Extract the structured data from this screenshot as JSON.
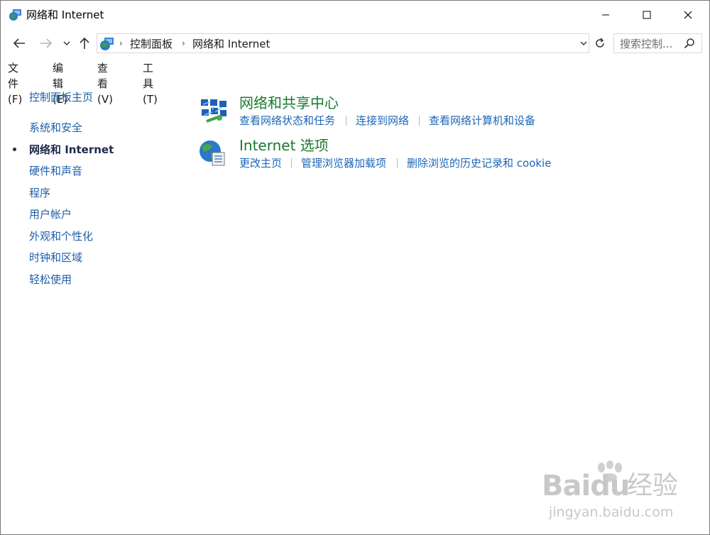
{
  "window": {
    "title": "网络和 Internet"
  },
  "address_bar": {
    "crumbs": [
      "控制面板",
      "网络和 Internet"
    ]
  },
  "search": {
    "placeholder": "搜索控制..."
  },
  "menu": {
    "items": [
      "文件(F)",
      "编辑(E)",
      "查看(V)",
      "工具(T)"
    ]
  },
  "sidebar": {
    "home": "控制面板主页",
    "items": [
      "系统和安全",
      "网络和 Internet",
      "硬件和声音",
      "程序",
      "用户帐户",
      "外观和个性化",
      "时钟和区域",
      "轻松使用"
    ],
    "active_index": 1
  },
  "categories": [
    {
      "title": "网络和共享中心",
      "icon": "network-sharing-center-icon",
      "tasks": [
        "查看网络状态和任务",
        "连接到网络",
        "查看网络计算机和设备"
      ]
    },
    {
      "title": "Internet 选项",
      "icon": "internet-options-icon",
      "tasks": [
        "更改主页",
        "管理浏览器加载项",
        "删除浏览的历史记录和 cookie"
      ]
    }
  ],
  "watermark": {
    "logo": "Baidu",
    "label": "经验",
    "url": "jingyan.baidu.com"
  },
  "colors": {
    "link": "#1c66b8",
    "category_title": "#1a7a2e",
    "active_nav": "#1c2a4a"
  }
}
